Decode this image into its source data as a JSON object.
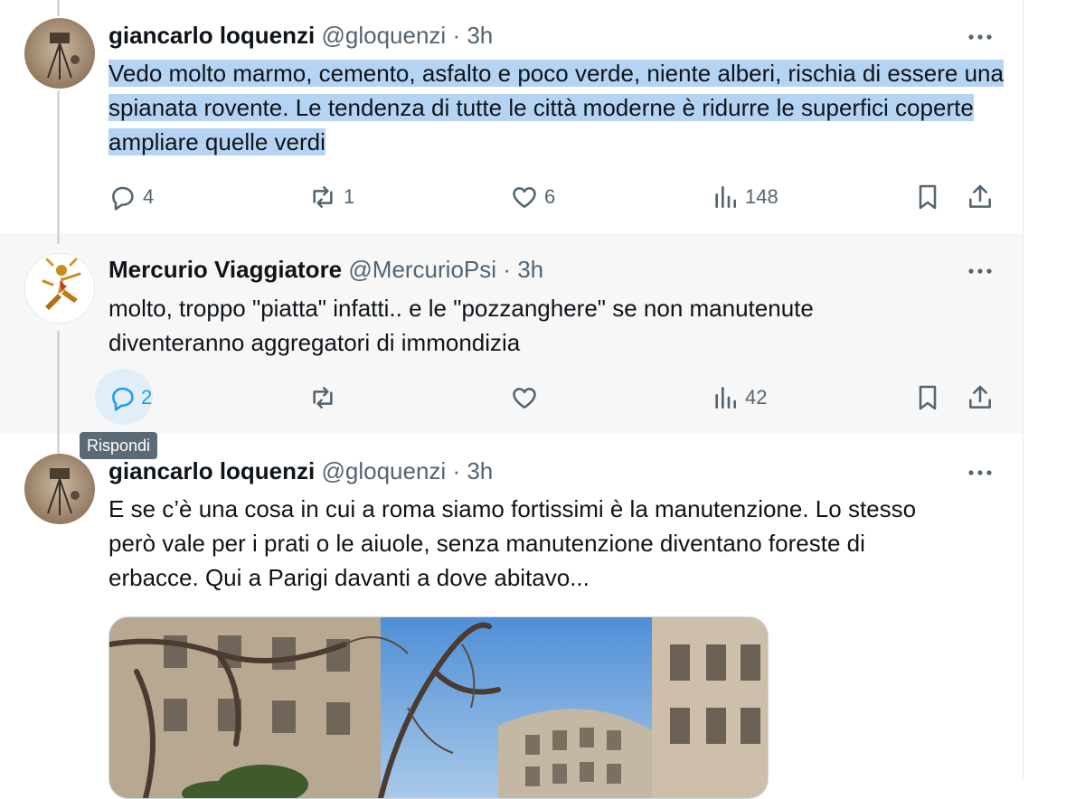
{
  "tweets": [
    {
      "name": "giancarlo loquenzi",
      "handle": "@gloquenzi",
      "separator": "·",
      "time": "3h",
      "text": "Vedo molto marmo, cemento, asfalto e poco verde, niente alberi, rischia di essere una spianata rovente. Le tendenza di tutte le città moderne è ridurre le superfici coperte  ampliare quelle verdi",
      "replies": "4",
      "reposts": "1",
      "likes": "6",
      "views": "148"
    },
    {
      "name": "Mercurio Viaggiatore",
      "handle": "@MercurioPsi",
      "separator": "·",
      "time": "3h",
      "text": "molto, troppo \"piatta\" infatti.. e le \"pozzanghere\" se non manutenute diventeranno aggregatori di immondizia",
      "replies": "2",
      "reposts": "",
      "likes": "",
      "views": "42"
    },
    {
      "name": "giancarlo loquenzi",
      "handle": "@gloquenzi",
      "separator": "·",
      "time": "3h",
      "text": "E se c’è una cosa in cui a roma siamo fortissimi è la manutenzione. Lo stesso però vale per i prati o le aiuole, senza manutenzione diventano foreste di erbacce. Qui a Parigi davanti a dove abitavo..."
    }
  ],
  "tooltip": "Rispondi",
  "icons": {
    "more": "more-horizontal-icon",
    "reply": "reply-icon",
    "repost": "repost-icon",
    "like": "like-icon",
    "views": "views-icon",
    "bookmark": "bookmark-icon",
    "share": "share-icon"
  },
  "colors": {
    "text": "#0f1419",
    "secondary": "#536471",
    "accent": "#1d9bf0",
    "selection": "#b5d4f4",
    "thread_line": "#cfd9de"
  }
}
